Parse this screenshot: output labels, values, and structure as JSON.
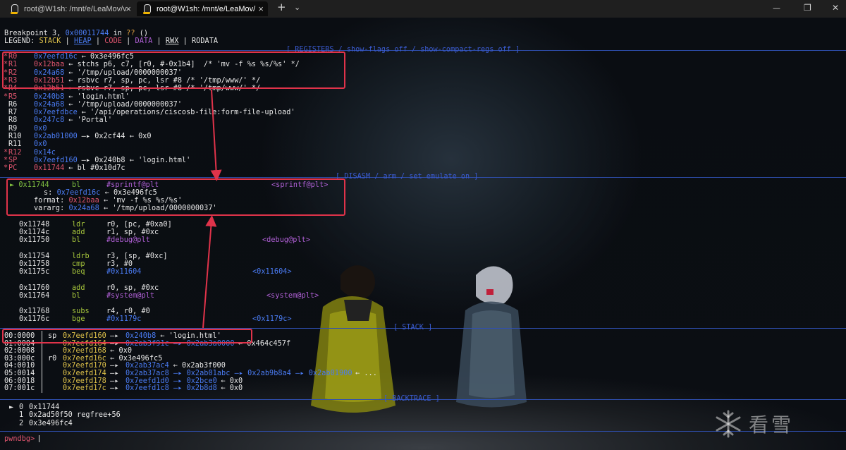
{
  "window": {
    "tabs": [
      {
        "title": "root@W1sh: /mnt/e/LeaMov/v",
        "active": false
      },
      {
        "title": "root@W1sh: /mnt/e/LeaMov/",
        "active": true
      }
    ],
    "new_tab": "+",
    "dropdown": "⌄",
    "minimize": "—",
    "maximize": "❐",
    "close": "✕"
  },
  "header": {
    "bp_prefix": "Breakpoint 3, ",
    "bp_addr": "0x00011744",
    "bp_in": " in ",
    "bp_fn": "??",
    "bp_suffix": " ()",
    "legend_label": "LEGEND: ",
    "legend": [
      "STACK",
      "HEAP",
      "CODE",
      "DATA",
      "RWX",
      "RODATA"
    ],
    "legend_sep": " | "
  },
  "sections": {
    "registers": "[ REGISTERS / show-flags off / show-compact-regs off ]",
    "disasm": "[ DISASM / arm / set emulate on ]",
    "stack": "[ STACK ]",
    "backtrace": "[ BACKTRACE ]"
  },
  "registers": [
    {
      "changed": true,
      "name": "R0",
      "val": "0x7eefd16c",
      "rest": " ← 0x3e496fc5"
    },
    {
      "changed": true,
      "name": "R1",
      "val": "0x12baa",
      "rest": " ← stchs p6, c7, [r0, #-0x1b4]  /* 'mv -f %s %s/%s' */"
    },
    {
      "changed": true,
      "name": "R2",
      "val": "0x24a68",
      "rest": " ← '/tmp/upload/0000000037'"
    },
    {
      "changed": true,
      "name": "R3",
      "val": "0x12b51",
      "rest": " ← rsbvc r7, sp, pc, lsr #8 /* '/tmp/www/' */"
    },
    {
      "changed": true,
      "name": "R4",
      "val": "0x12b51",
      "rest": " ← rsbvc r7, sp, pc, lsr #8 /* '/tmp/www/' */"
    },
    {
      "changed": true,
      "name": "R5",
      "val": "0x240b8",
      "rest": " ← 'login.html'"
    },
    {
      "changed": false,
      "name": "R6",
      "val": "0x24a68",
      "rest": " ← '/tmp/upload/0000000037'"
    },
    {
      "changed": false,
      "name": "R7",
      "val": "0x7eefdbce",
      "rest": " ← '/api/operations/ciscosb-file:form-file-upload'"
    },
    {
      "changed": false,
      "name": "R8",
      "val": "0x247c8",
      "rest": " ← 'Portal'"
    },
    {
      "changed": false,
      "name": "R9",
      "val": "0x0",
      "rest": ""
    },
    {
      "changed": false,
      "name": "R10",
      "val": "0x2ab01000",
      "rest": " —▸ 0x2cf44 ← 0x0"
    },
    {
      "changed": false,
      "name": "R11",
      "val": "0x0",
      "rest": ""
    },
    {
      "changed": true,
      "name": "R12",
      "val": "0x14c",
      "rest": ""
    },
    {
      "changed": true,
      "name": "SP",
      "val": "0x7eefd160",
      "rest": " —▸ 0x240b8 ← 'login.html'"
    },
    {
      "changed": true,
      "name": "PC",
      "val": "0x11744",
      "rest": " ← bl #0x10d7c"
    }
  ],
  "disasm_current": {
    "marker": "►",
    "addr": "0x11744",
    "mnem": "bl",
    "op": "#sprintf@plt",
    "target": "<sprintf@plt>",
    "args": [
      {
        "k": "s:",
        "v": "0x7eefd16c",
        "rest": " ← 0x3e496fc5"
      },
      {
        "k": "format:",
        "v": "0x12baa",
        "rest": " ← 'mv -f %s %s/%s'"
      },
      {
        "k": "vararg:",
        "v": "0x24a68",
        "rest": " ← '/tmp/upload/0000000037'"
      }
    ]
  },
  "disasm": [
    {
      "addr": "0x11748",
      "mnem": "ldr",
      "op": "r0, [pc, #0xa0]",
      "target": ""
    },
    {
      "addr": "0x1174c",
      "mnem": "add",
      "op": "r1, sp, #0xc",
      "target": ""
    },
    {
      "addr": "0x11750",
      "mnem": "bl",
      "op": "#debug@plt",
      "target": "<debug@plt>"
    },
    {
      "addr": "0x11754",
      "mnem": "ldrb",
      "op": "r3, [sp, #0xc]",
      "target": ""
    },
    {
      "addr": "0x11758",
      "mnem": "cmp",
      "op": "r3, #0",
      "target": ""
    },
    {
      "addr": "0x1175c",
      "mnem": "beq",
      "op": "#0x11604",
      "target": "<0x11604>"
    },
    {
      "addr": "0x11760",
      "mnem": "add",
      "op": "r0, sp, #0xc",
      "target": ""
    },
    {
      "addr": "0x11764",
      "mnem": "bl",
      "op": "#system@plt",
      "target": "<system@plt>"
    },
    {
      "addr": "0x11768",
      "mnem": "subs",
      "op": "r4, r0, #0",
      "target": ""
    },
    {
      "addr": "0x1176c",
      "mnem": "bge",
      "op": "#0x1179c",
      "target": "<0x1179c>"
    }
  ],
  "stack": [
    {
      "off": "00:0000",
      "reg": "sp",
      "addr": "0x7eefd160",
      "rest": " —▸ ",
      "val2": "0x240b8",
      "tail": " ← 'login.html'"
    },
    {
      "off": "01:0004",
      "reg": "",
      "addr": "0x7eefd164",
      "rest": " —▸ ",
      "val2": "0x2ab3f91c —▸ 0x2ab3a0000",
      "tail": " ← 0x464c457f"
    },
    {
      "off": "02:0008",
      "reg": "",
      "addr": "0x7eefd168",
      "rest": " ← 0x0",
      "val2": "",
      "tail": ""
    },
    {
      "off": "03:000c",
      "reg": "r0",
      "addr": "0x7eefd16c",
      "rest": " ← 0x3e496fc5",
      "val2": "",
      "tail": ""
    },
    {
      "off": "04:0010",
      "reg": "",
      "addr": "0x7eefd170",
      "rest": " —▸ ",
      "val2": "0x2ab37ac4",
      "tail": " ← 0x2ab3f000"
    },
    {
      "off": "05:0014",
      "reg": "",
      "addr": "0x7eefd174",
      "rest": " —▸ ",
      "val2": "0x2ab37ac8 —▸ 0x2ab01abc —▸ 0x2ab9b8a4 —▸ 0x2ab01900",
      "tail": " ← ..."
    },
    {
      "off": "06:0018",
      "reg": "",
      "addr": "0x7eefd178",
      "rest": " —▸ ",
      "val2": "0x7eefd1d0 —▸ 0x2bce0",
      "tail": " ← 0x0"
    },
    {
      "off": "07:001c",
      "reg": "",
      "addr": "0x7eefd17c",
      "rest": " —▸ ",
      "val2": "0x7eefd1c8 —▸ 0x2b8d8",
      "tail": " ← 0x0"
    }
  ],
  "backtrace": [
    {
      "marker": "►",
      "idx": "0",
      "text": "0x11744"
    },
    {
      "marker": "",
      "idx": "1",
      "text": "0x2ad50f50 regfree+56"
    },
    {
      "marker": "",
      "idx": "2",
      "text": "0x3e496fc4"
    }
  ],
  "prompt": "pwndbg> ",
  "watermark": "看雪"
}
